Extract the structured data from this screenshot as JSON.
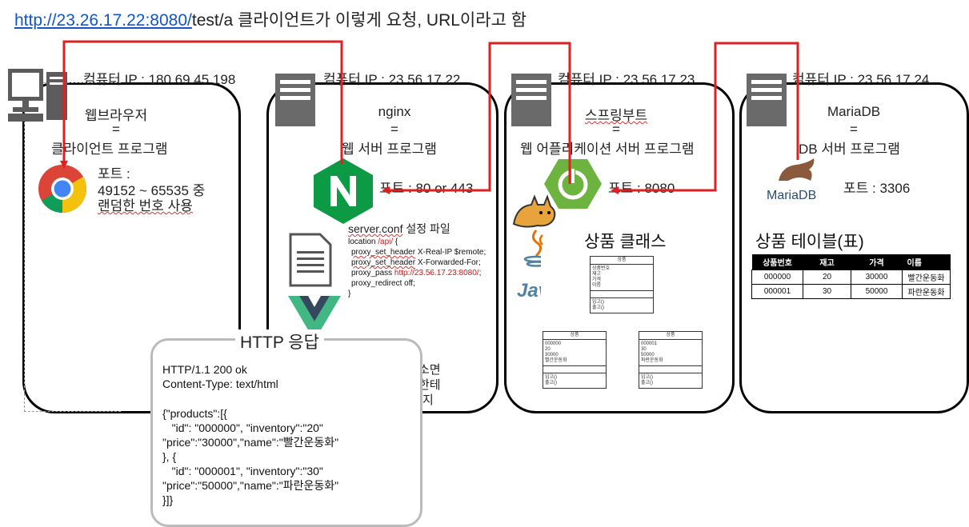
{
  "header": {
    "url": "http://23.26.17.22:8080/",
    "path": "test/a",
    "caption": " 클라이언트가 이렇게 요청, URL이라고 함"
  },
  "client": {
    "ip": "컴퓨터 IP : 180.69.45.198",
    "name": "웹브라우저",
    "eq": "=",
    "role": "클라이언트 프로그램",
    "port_label": "포트 :",
    "port_range": "49152 ~ 65535 중",
    "port_note": "랜덤한 번호 사용"
  },
  "nginx": {
    "ip": "컴퓨터 IP : 23.56.17.22",
    "name": "nginx",
    "eq": "=",
    "role": "웹 서버 프로그램",
    "port": "포트 : 80 or 443",
    "conf_title_a": "server.conf",
    "conf_title_b": " 설정 파일",
    "conf_lines": {
      "l1a": "location ",
      "l1b": "/api/",
      "l1c": " {",
      "l2a": "proxy_set_header",
      "l2b": " X-Real-IP $remote;",
      "l3a": "proxy_set_header",
      "l3b": " X-Forwarded-For;",
      "l4a": "proxy_pass ",
      "l4b": "http://23.56.17.23:8080/",
      "l4c": ";",
      "l5": "proxy_redirect off;",
      "l6": "}"
    },
    "partial_1": "소면",
    "partial_2": "한테",
    "partial_3": "지"
  },
  "spring": {
    "ip": "컴퓨터 IP : 23.56.17.23",
    "name": "스프링부트",
    "eq": "=",
    "role": "웹 어플리케이션 서버 프로그램",
    "port": "포트 : 8080",
    "java": "Java",
    "class_title": "상품 클래스",
    "uml_class": {
      "header": "상품",
      "fields": [
        "상품번호",
        "재고",
        "가격",
        "이름"
      ],
      "methods": [
        "입고()",
        "출고()"
      ]
    },
    "uml_obj1": {
      "header": "상품",
      "fields": [
        "000000",
        "20",
        "30000",
        "빨간운동화"
      ],
      "methods": [
        "입고()",
        "출고()"
      ]
    },
    "uml_obj2": {
      "header": "상품",
      "fields": [
        "000001",
        "30",
        "50000",
        "파란운동화"
      ],
      "methods": [
        "입고()",
        "출고()"
      ]
    }
  },
  "maria": {
    "ip": "컴퓨터 IP : 23.56.17.24",
    "name": "MariaDB",
    "eq": "=",
    "role": "DB 서버 프로그램",
    "port": "포트 : 3306",
    "logo_text": "MariaDB",
    "table_title": "상품 테이블(표)",
    "table": {
      "headers": [
        "상품번호",
        "재고",
        "가격",
        "이름"
      ],
      "rows": [
        [
          "000000",
          "20",
          "30000",
          "빨간운동화"
        ],
        [
          "000001",
          "30",
          "50000",
          "파란운동화"
        ]
      ]
    }
  },
  "http": {
    "title": "HTTP 응답",
    "status": "HTTP/1.1 200 ok",
    "content_type": "Content-Type: text/html",
    "body_1": "{\"products\":[{",
    "body_2": "   \"id\": \"000000\", \"inventory\":\"20\"",
    "body_3": "\"price\":\"30000\",\"name\":\"빨간운동화\"",
    "body_4": "}, {",
    "body_5": "   \"id\": \"000001\", \"inventory\":\"30\"",
    "body_6": "\"price\":\"50000\",\"name\":\"파란운동화\"",
    "body_7": "}]}"
  },
  "colors": {
    "arrow": "#e02020",
    "panel_border": "#000000",
    "link": "#1155cc",
    "nginx_green": "#0d9a45",
    "spring_green": "#6db33f",
    "chrome_red": "#db4437",
    "chrome_yellow": "#f4c20d",
    "chrome_green": "#0f9d58",
    "chrome_blue": "#4285f4"
  }
}
